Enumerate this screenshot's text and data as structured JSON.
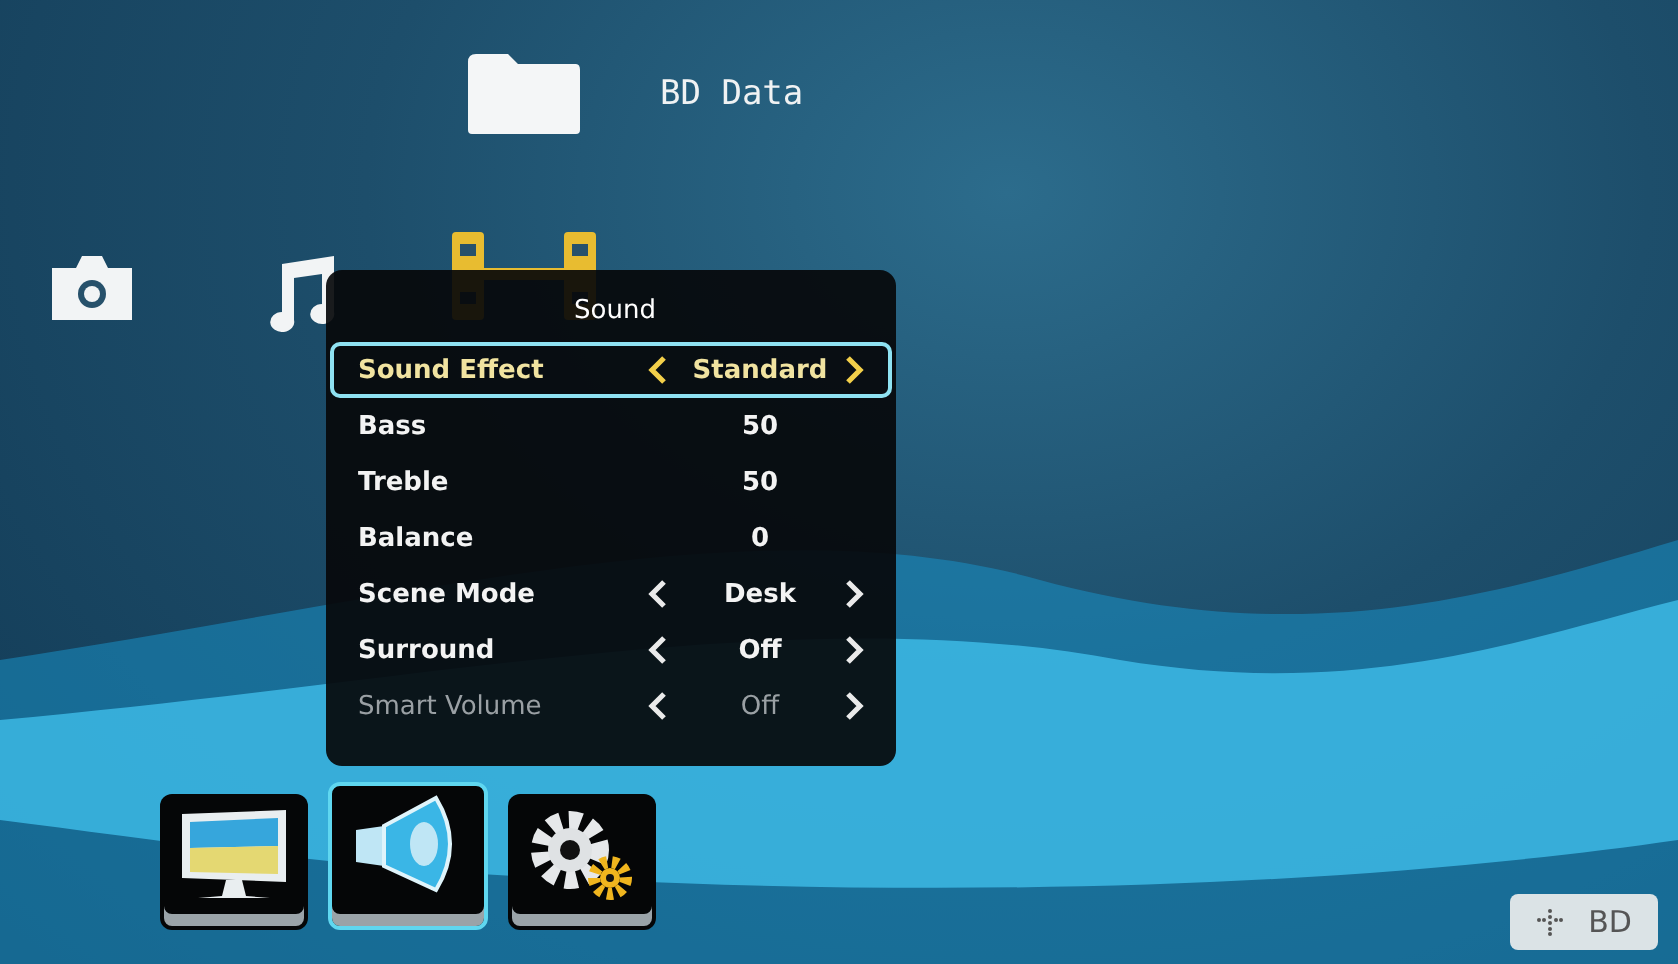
{
  "header": {
    "label": "BD Data"
  },
  "panel": {
    "title": "Sound",
    "items": [
      {
        "kind": "select",
        "label": "Sound Effect",
        "value": "Standard",
        "selected": true,
        "disabled": false
      },
      {
        "kind": "value",
        "label": "Bass",
        "value": "50",
        "selected": false,
        "disabled": false
      },
      {
        "kind": "value",
        "label": "Treble",
        "value": "50",
        "selected": false,
        "disabled": false
      },
      {
        "kind": "value",
        "label": "Balance",
        "value": "0",
        "selected": false,
        "disabled": false
      },
      {
        "kind": "select",
        "label": "Scene Mode",
        "value": "Desk",
        "selected": false,
        "disabled": false
      },
      {
        "kind": "select",
        "label": "Surround",
        "value": "Off",
        "selected": false,
        "disabled": false
      },
      {
        "kind": "select",
        "label": "Smart Volume",
        "value": "Off",
        "selected": false,
        "disabled": true
      }
    ]
  },
  "media_icons": [
    {
      "kind": "photo",
      "selected": false
    },
    {
      "kind": "music",
      "selected": false
    },
    {
      "kind": "video",
      "selected": true
    }
  ],
  "setup_tabs": [
    {
      "kind": "display",
      "selected": false
    },
    {
      "kind": "audio",
      "selected": true
    },
    {
      "kind": "system",
      "selected": false
    }
  ],
  "source_badge": {
    "label": "BD"
  }
}
